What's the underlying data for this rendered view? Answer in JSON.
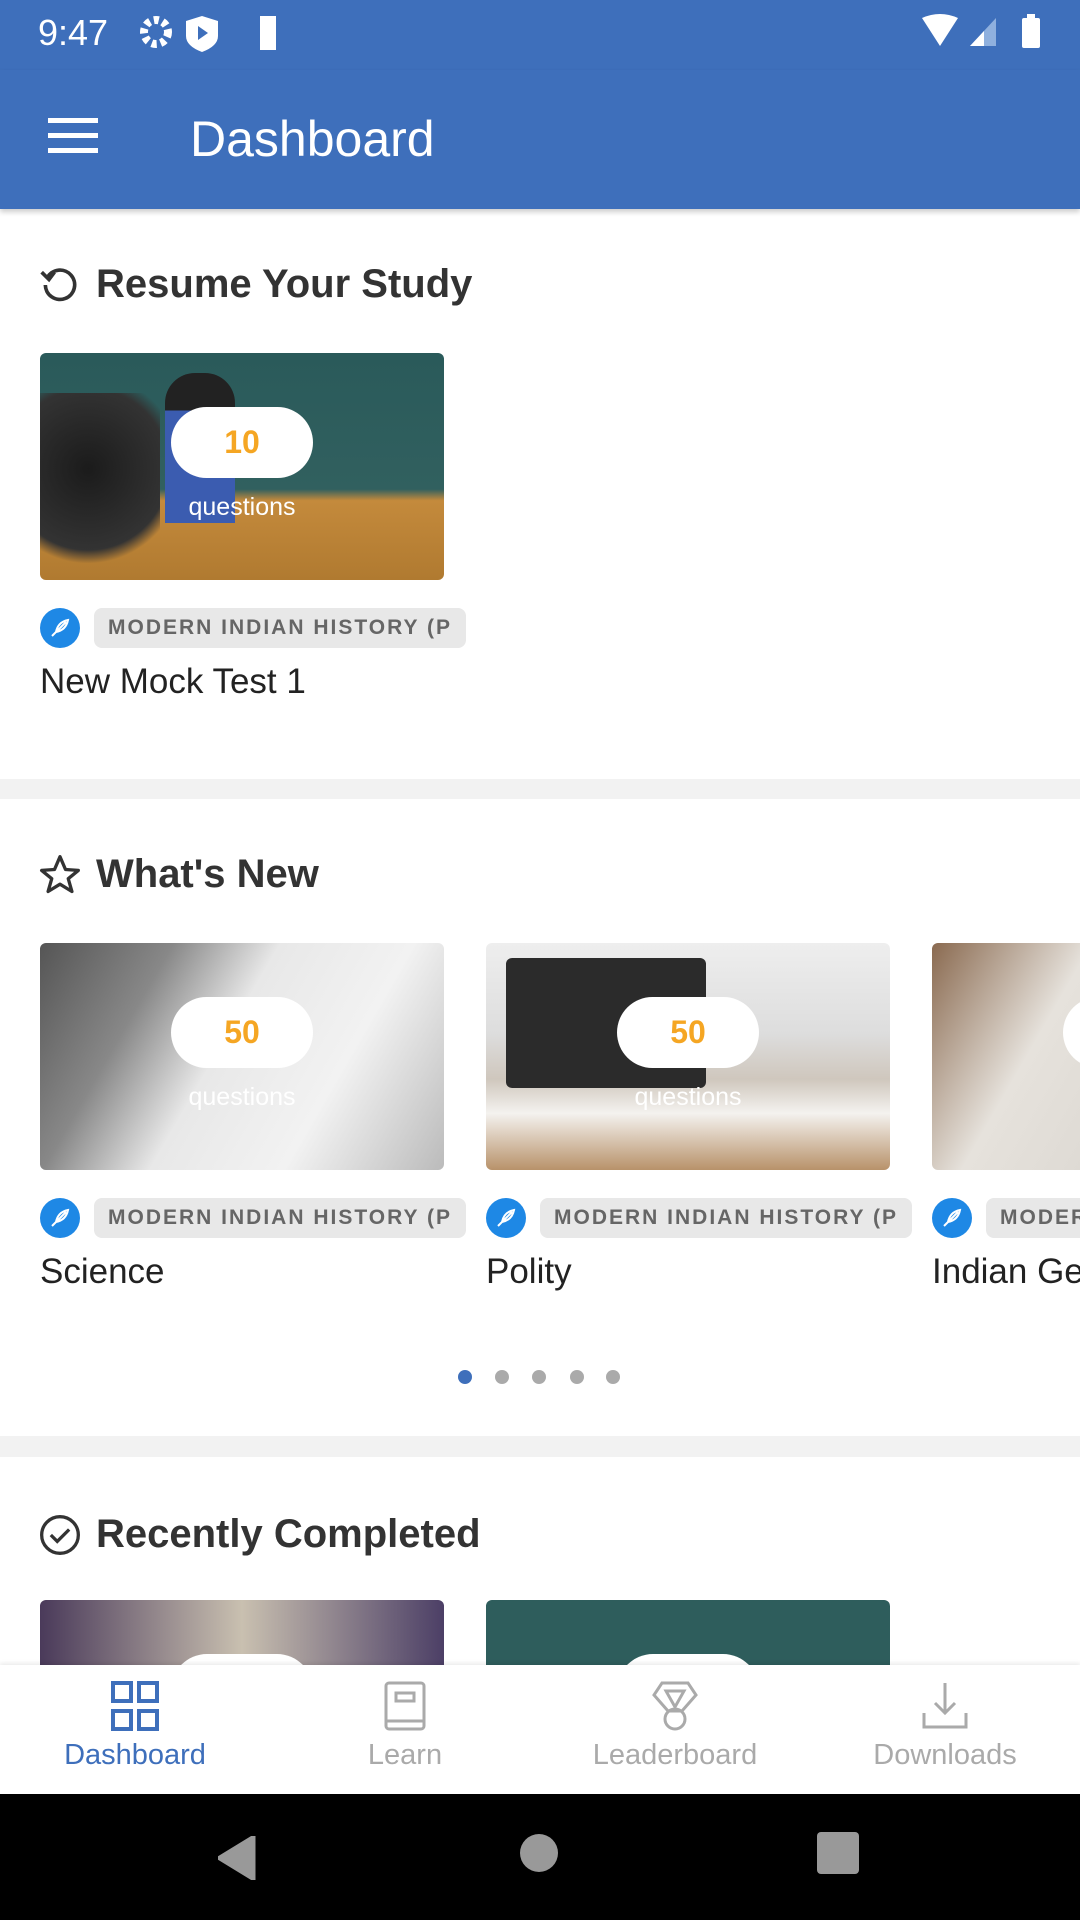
{
  "status_bar": {
    "time": "9:47",
    "icons": [
      "gear-icon",
      "shield-play-icon",
      "sd-card-icon",
      "wifi-icon",
      "signal-icon",
      "battery-icon"
    ]
  },
  "app_bar": {
    "title": "Dashboard",
    "menu_icon": "hamburger-icon"
  },
  "resume": {
    "heading": "Resume Your Study",
    "icon": "history-icon",
    "cards": [
      {
        "count": "10",
        "count_label": "questions",
        "tag": "MODERN INDIAN HISTORY (P",
        "title": "New Mock Test 1"
      }
    ]
  },
  "whats_new": {
    "heading": "What's New",
    "icon": "star-icon",
    "cards": [
      {
        "count": "50",
        "count_label": "questions",
        "tag": "MODERN INDIAN HISTORY (P",
        "title": "Science"
      },
      {
        "count": "50",
        "count_label": "questions",
        "tag": "MODERN INDIAN HISTORY (P",
        "title": "Polity"
      },
      {
        "count": "",
        "count_label": "",
        "tag": "MODERN INDIAN HISTORY (P",
        "title": "Indian Ge"
      }
    ],
    "pager": {
      "pages": 5,
      "active": 1
    }
  },
  "recently_completed": {
    "heading": "Recently Completed",
    "icon": "check-circle-icon"
  },
  "bottom_nav": {
    "items": [
      {
        "label": "Dashboard",
        "active": true
      },
      {
        "label": "Learn"
      },
      {
        "label": "Leaderboard"
      },
      {
        "label": "Downloads"
      }
    ]
  },
  "colors": {
    "primary": "#3e6fbb",
    "accent": "#f5a623",
    "tag_icon": "#1e88e5"
  }
}
